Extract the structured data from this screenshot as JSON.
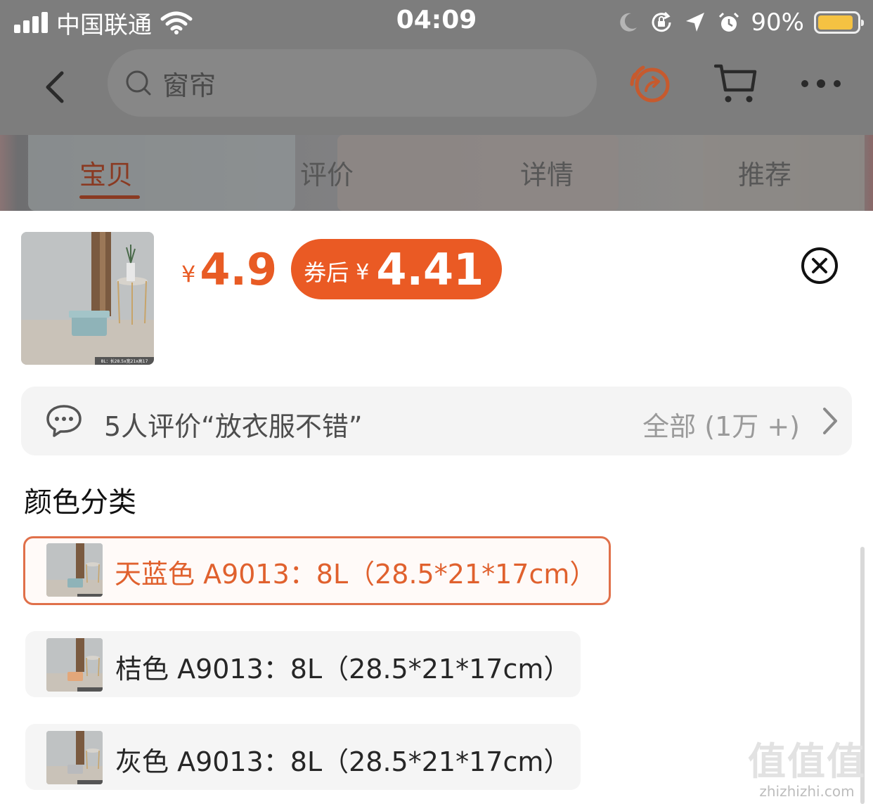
{
  "status_bar": {
    "carrier": "中国联通",
    "time": "04:09",
    "battery_percent": "90%",
    "battery_level": 0.9,
    "battery_color": "#f5c242",
    "icons": [
      "signal-icon",
      "wifi-icon",
      "moon-icon",
      "orientation-lock-icon",
      "location-icon",
      "alarm-icon",
      "battery-icon"
    ]
  },
  "nav": {
    "back_icon": "chevron-left-icon",
    "search_placeholder": "窗帘",
    "share_icon": "share-icon",
    "share_color": "#c65a2e",
    "cart_icon": "cart-icon",
    "more_icon": "more-dots-icon"
  },
  "tabs": [
    {
      "label": "宝贝",
      "active": true
    },
    {
      "label": "评价",
      "active": false
    },
    {
      "label": "详情",
      "active": false
    },
    {
      "label": "推荐",
      "active": false
    }
  ],
  "product": {
    "thumb_caption": "8L：长28.5x宽21x高17",
    "currency": "¥",
    "price": "4.9",
    "coupon_label": "券后",
    "coupon_currency": "¥",
    "coupon_price": "4.41",
    "accent_color": "#ea5a24"
  },
  "close_icon": "close-circle-icon",
  "review": {
    "icon": "chat-bubble-icon",
    "text": "5人评价“放衣服不错”",
    "all_label": "全部 (1万 +)",
    "chevron_icon": "chevron-right-icon"
  },
  "sku": {
    "title": "颜色分类",
    "options": [
      {
        "label": "天蓝色 A9013：8L（28.5*21*17cm）",
        "selected": true,
        "box_color": "#8fb3b8"
      },
      {
        "label": "桔色 A9013：8L（28.5*21*17cm）",
        "selected": false,
        "box_color": "#e3a77a"
      },
      {
        "label": "灰色 A9013：8L（28.5*21*17cm）",
        "selected": false,
        "box_color": "#b9babd"
      }
    ]
  },
  "watermark": {
    "main": "值值值",
    "sub": "zhizhizhi.com"
  }
}
